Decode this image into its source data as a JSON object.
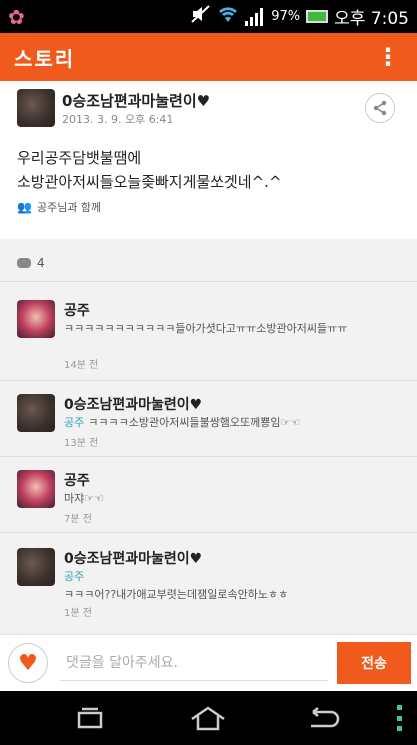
{
  "status_bar": {
    "battery_percent": "97%",
    "time": "오후 7:05"
  },
  "appbar": {
    "title": "스토리"
  },
  "post": {
    "author": "0승조남편과마눌련이♥",
    "date": "2013. 3. 9. 오후 6:41",
    "body_line1": "우리공주담뱃불땜에",
    "body_line2": "소방관아저씨들오늘좆빠지게물쏘겟네^.^",
    "with_text": "공주님과 함께"
  },
  "comment_count": "4",
  "comments": [
    {
      "name": "공주",
      "mention": "",
      "text": "ㅋㅋㅋㅋㅋㅋㅋㅋㅋㅋㅋ들아가셧다고ㅠㅠ소방관아저씨들ㅠㅠ",
      "time": "14분 전",
      "avatar": "pink"
    },
    {
      "name": "0승조남편과마눌련이♥",
      "mention": "공주",
      "text": "ㅋㅋㅋㅋ소방관아저씨들불쌍햄오또께뿅임☞☜",
      "time": "13분 전",
      "avatar": "dark"
    },
    {
      "name": "공주",
      "mention": "",
      "text": "마쟈☞☜",
      "time": "7분 전",
      "avatar": "pink"
    },
    {
      "name": "0승조남편과마눌련이♥",
      "mention": "공주",
      "text": "ㅋㅋㅋ어??내가애교부렷는데잼일로속안하노ㅎㅎ",
      "time": "1분 전",
      "avatar": "dark"
    }
  ],
  "input": {
    "placeholder": "댓글을 달아주세요.",
    "send_label": "전송"
  },
  "colors": {
    "accent": "#f05a1c",
    "mention": "#2fa3b8"
  }
}
